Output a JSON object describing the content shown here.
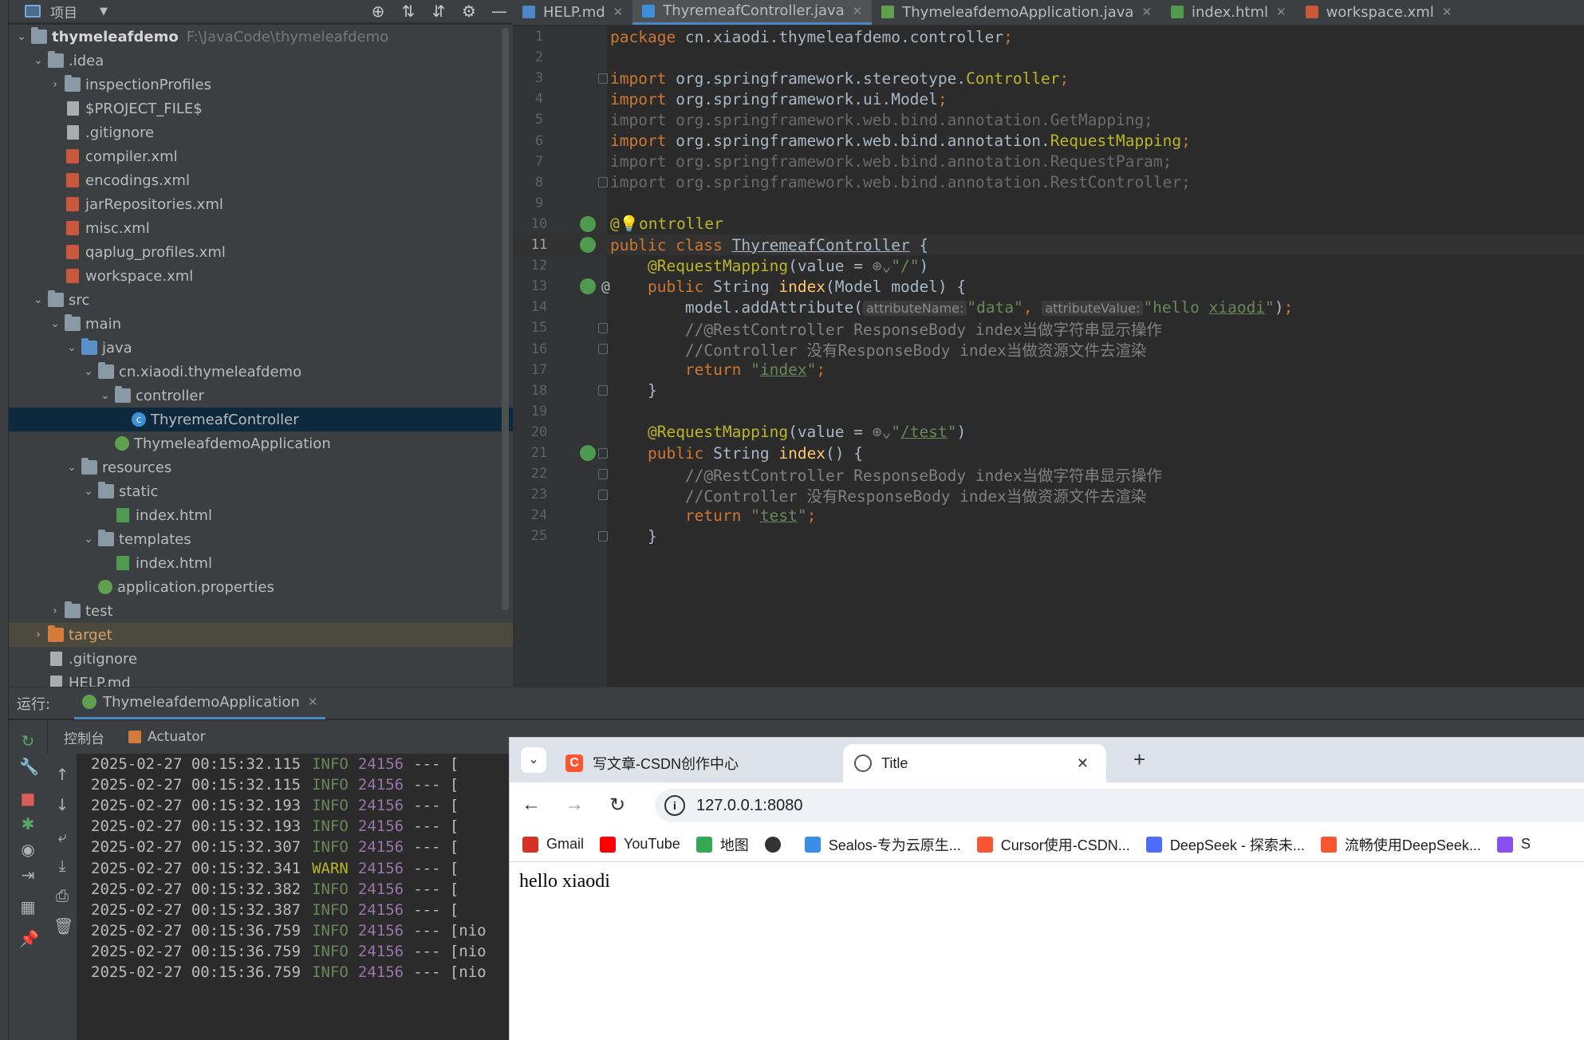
{
  "project_panel": {
    "title": "项目",
    "tree": [
      {
        "depth": 0,
        "arrow": "open",
        "icon": "folder",
        "label": "thymeleafdemo",
        "path": "F:\\JavaCode\\thymeleafdemo",
        "bold": true
      },
      {
        "depth": 1,
        "arrow": "open",
        "icon": "folder",
        "label": ".idea"
      },
      {
        "depth": 2,
        "arrow": "closed",
        "icon": "folder",
        "label": "inspectionProfiles"
      },
      {
        "depth": 2,
        "arrow": "none",
        "icon": "file",
        "label": "$PROJECT_FILE$"
      },
      {
        "depth": 2,
        "arrow": "none",
        "icon": "file",
        "label": ".gitignore"
      },
      {
        "depth": 2,
        "arrow": "none",
        "icon": "xml",
        "label": "compiler.xml"
      },
      {
        "depth": 2,
        "arrow": "none",
        "icon": "xml",
        "label": "encodings.xml"
      },
      {
        "depth": 2,
        "arrow": "none",
        "icon": "xml",
        "label": "jarRepositories.xml"
      },
      {
        "depth": 2,
        "arrow": "none",
        "icon": "xml",
        "label": "misc.xml"
      },
      {
        "depth": 2,
        "arrow": "none",
        "icon": "xml",
        "label": "qaplug_profiles.xml"
      },
      {
        "depth": 2,
        "arrow": "none",
        "icon": "xml",
        "label": "workspace.xml"
      },
      {
        "depth": 1,
        "arrow": "open",
        "icon": "folder",
        "label": "src"
      },
      {
        "depth": 2,
        "arrow": "open",
        "icon": "folder",
        "label": "main"
      },
      {
        "depth": 3,
        "arrow": "open",
        "icon": "folder-blue",
        "label": "java"
      },
      {
        "depth": 4,
        "arrow": "open",
        "icon": "folder",
        "label": "cn.xiaodi.thymeleafdemo"
      },
      {
        "depth": 5,
        "arrow": "open",
        "icon": "folder",
        "label": "controller"
      },
      {
        "depth": 6,
        "arrow": "none",
        "icon": "class",
        "label": "ThyremeafController",
        "selected": true
      },
      {
        "depth": 5,
        "arrow": "none",
        "icon": "spring",
        "label": "ThymeleafdemoApplication"
      },
      {
        "depth": 3,
        "arrow": "open",
        "icon": "folder",
        "label": "resources"
      },
      {
        "depth": 4,
        "arrow": "open",
        "icon": "folder",
        "label": "static"
      },
      {
        "depth": 5,
        "arrow": "none",
        "icon": "html",
        "label": "index.html"
      },
      {
        "depth": 4,
        "arrow": "open",
        "icon": "folder",
        "label": "templates"
      },
      {
        "depth": 5,
        "arrow": "none",
        "icon": "html",
        "label": "index.html"
      },
      {
        "depth": 4,
        "arrow": "none",
        "icon": "spring",
        "label": "application.properties"
      },
      {
        "depth": 2,
        "arrow": "closed",
        "icon": "folder",
        "label": "test"
      },
      {
        "depth": 1,
        "arrow": "closed",
        "icon": "folder-orange",
        "label": "target",
        "target": true
      },
      {
        "depth": 1,
        "arrow": "none",
        "icon": "file",
        "label": ".gitignore"
      },
      {
        "depth": 1,
        "arrow": "none",
        "icon": "file",
        "label": "HELP.md"
      }
    ]
  },
  "editor_tabs": [
    {
      "label": "HELP.md",
      "icon_color": "#4a88c7",
      "active": false
    },
    {
      "label": "ThyremeafController.java",
      "icon_color": "#3d8fd8",
      "active": true
    },
    {
      "label": "ThymeleafdemoApplication.java",
      "icon_color": "#5fa04e",
      "active": false
    },
    {
      "label": "index.html",
      "icon_color": "#4e9a4f",
      "active": false
    },
    {
      "label": "workspace.xml",
      "icon_color": "#c8573c",
      "active": false
    }
  ],
  "editor": {
    "current_line": 11,
    "lines": [
      {
        "n": 1,
        "tokens": [
          [
            "kw",
            "package "
          ],
          [
            "plain",
            "cn.xiaodi.thymeleafdemo.controller"
          ],
          [
            "kw",
            ";"
          ]
        ]
      },
      {
        "n": 2,
        "tokens": []
      },
      {
        "n": 3,
        "fold": true,
        "tokens": [
          [
            "kw",
            "import "
          ],
          [
            "plain",
            "org.springframework.stereotype."
          ],
          [
            "an",
            "Controller"
          ],
          [
            "kw",
            ";"
          ]
        ]
      },
      {
        "n": 4,
        "tokens": [
          [
            "kw",
            "import "
          ],
          [
            "plain",
            "org.springframework.ui.Model"
          ],
          [
            "kw",
            ";"
          ]
        ]
      },
      {
        "n": 5,
        "tokens": [
          [
            "dim",
            "import org.springframework.web.bind.annotation.GetMapping;"
          ]
        ]
      },
      {
        "n": 6,
        "tokens": [
          [
            "kw",
            "import "
          ],
          [
            "plain",
            "org.springframework.web.bind.annotation."
          ],
          [
            "an",
            "RequestMapping"
          ],
          [
            "kw",
            ";"
          ]
        ]
      },
      {
        "n": 7,
        "tokens": [
          [
            "dim",
            "import org.springframework.web.bind.annotation.RequestParam;"
          ]
        ]
      },
      {
        "n": 8,
        "fold": true,
        "tokens": [
          [
            "dim",
            "import org.springframework.web.bind.annotation.RestController;"
          ]
        ]
      },
      {
        "n": 9,
        "tokens": []
      },
      {
        "n": 10,
        "gicon": true,
        "tokens": [
          [
            "an",
            "@"
          ],
          [
            "fn",
            "💡"
          ],
          [
            "an",
            "ontroller"
          ]
        ]
      },
      {
        "n": 11,
        "gicon": true,
        "tokens": [
          [
            "kw",
            "public class "
          ],
          [
            "ulplain",
            "ThyremeafController"
          ],
          [
            "plain",
            " {"
          ]
        ]
      },
      {
        "n": 12,
        "tokens": [
          [
            "plain",
            "    "
          ],
          [
            "an",
            "@RequestMapping"
          ],
          [
            "plain",
            "(value = "
          ],
          [
            "cm",
            "⊕⌄"
          ],
          [
            "str",
            "\"/\""
          ],
          [
            "plain",
            ")"
          ]
        ]
      },
      {
        "n": 13,
        "gicon": true,
        "at": true,
        "fold": true,
        "tokens": [
          [
            "plain",
            "    "
          ],
          [
            "kw",
            "public "
          ],
          [
            "plain",
            "String "
          ],
          [
            "fn",
            "index"
          ],
          [
            "plain",
            "(Model model) {"
          ]
        ]
      },
      {
        "n": 14,
        "tokens": [
          [
            "plain",
            "        model.addAttribute("
          ],
          [
            "hint",
            "attributeName:"
          ],
          [
            "str",
            "\"data\""
          ],
          [
            "kw",
            ", "
          ],
          [
            "hint",
            "attributeValue:"
          ],
          [
            "str",
            "\"hello "
          ],
          [
            "ulstr",
            "xiaodi"
          ],
          [
            "str",
            "\""
          ],
          [
            "plain",
            ")"
          ],
          [
            "kw",
            ";"
          ]
        ]
      },
      {
        "n": 15,
        "fold": true,
        "tokens": [
          [
            "cm",
            "        //@RestController ResponseBody index当做字符串显示操作"
          ]
        ]
      },
      {
        "n": 16,
        "fold": true,
        "tokens": [
          [
            "cm",
            "        //Controller 没有ResponseBody index当做资源文件去渲染"
          ]
        ]
      },
      {
        "n": 17,
        "tokens": [
          [
            "plain",
            "        "
          ],
          [
            "kw",
            "return "
          ],
          [
            "str",
            "\""
          ],
          [
            "ulstr",
            "index"
          ],
          [
            "str",
            "\""
          ],
          [
            "kw",
            ";"
          ]
        ]
      },
      {
        "n": 18,
        "fold": true,
        "tokens": [
          [
            "plain",
            "    }"
          ]
        ]
      },
      {
        "n": 19,
        "tokens": []
      },
      {
        "n": 20,
        "tokens": [
          [
            "plain",
            "    "
          ],
          [
            "an",
            "@RequestMapping"
          ],
          [
            "plain",
            "(value = "
          ],
          [
            "cm",
            "⊕⌄"
          ],
          [
            "str",
            "\""
          ],
          [
            "ulstr",
            "/test"
          ],
          [
            "str",
            "\""
          ],
          [
            "plain",
            ")"
          ]
        ]
      },
      {
        "n": 21,
        "gicon": true,
        "fold": true,
        "tokens": [
          [
            "plain",
            "    "
          ],
          [
            "kw",
            "public "
          ],
          [
            "plain",
            "String "
          ],
          [
            "fn",
            "index"
          ],
          [
            "plain",
            "() {"
          ]
        ]
      },
      {
        "n": 22,
        "fold": true,
        "tokens": [
          [
            "cm",
            "        //@RestController ResponseBody index当做字符串显示操作"
          ]
        ]
      },
      {
        "n": 23,
        "fold": true,
        "tokens": [
          [
            "cm",
            "        //Controller 没有ResponseBody index当做资源文件去渲染"
          ]
        ]
      },
      {
        "n": 24,
        "tokens": [
          [
            "plain",
            "        "
          ],
          [
            "kw",
            "return "
          ],
          [
            "str",
            "\""
          ],
          [
            "ulstr",
            "test"
          ],
          [
            "str",
            "\""
          ],
          [
            "kw",
            ";"
          ]
        ]
      },
      {
        "n": 25,
        "fold": true,
        "tokens": [
          [
            "plain",
            "    }"
          ]
        ]
      }
    ]
  },
  "run_panel": {
    "label": "运行:",
    "run_tab": "ThymeleafdemoApplication",
    "console_tab": "控制台",
    "actuator_tab": "Actuator",
    "log": [
      {
        "ts": "2025-02-27 00:15:32.115",
        "level": "INFO",
        "pid": "24156",
        "rest": "--- ["
      },
      {
        "ts": "2025-02-27 00:15:32.115",
        "level": "INFO",
        "pid": "24156",
        "rest": "--- ["
      },
      {
        "ts": "2025-02-27 00:15:32.193",
        "level": "INFO",
        "pid": "24156",
        "rest": "--- ["
      },
      {
        "ts": "2025-02-27 00:15:32.193",
        "level": "INFO",
        "pid": "24156",
        "rest": "--- ["
      },
      {
        "ts": "2025-02-27 00:15:32.307",
        "level": "INFO",
        "pid": "24156",
        "rest": "--- ["
      },
      {
        "ts": "2025-02-27 00:15:32.341",
        "level": "WARN",
        "pid": "24156",
        "rest": "--- ["
      },
      {
        "ts": "2025-02-27 00:15:32.382",
        "level": "INFO",
        "pid": "24156",
        "rest": "--- ["
      },
      {
        "ts": "2025-02-27 00:15:32.387",
        "level": "INFO",
        "pid": "24156",
        "rest": "--- ["
      },
      {
        "ts": "2025-02-27 00:15:36.759",
        "level": "INFO",
        "pid": "24156",
        "rest": "--- [nio"
      },
      {
        "ts": "2025-02-27 00:15:36.759",
        "level": "INFO",
        "pid": "24156",
        "rest": "--- [nio"
      },
      {
        "ts": "2025-02-27 00:15:36.759",
        "level": "INFO",
        "pid": "24156",
        "rest": "--- [nio"
      }
    ]
  },
  "browser": {
    "tabs": [
      {
        "title": "写文章-CSDN创作中心",
        "favicon": "csdn-icon",
        "active": false
      },
      {
        "title": "Title",
        "favicon": "globe-icon",
        "active": true
      }
    ],
    "url": "127.0.0.1:8080",
    "bookmarks": [
      {
        "label": "Gmail",
        "icon": "gmail-icon",
        "color": "#d93025"
      },
      {
        "label": "YouTube",
        "icon": "youtube-icon",
        "color": "#ff0000"
      },
      {
        "label": "地图",
        "icon": "maps-icon",
        "color": "#34a853"
      },
      {
        "label": "",
        "icon": "globe-icon",
        "color": "#333333"
      },
      {
        "label": "Sealos-专为云原生...",
        "icon": "sealos-icon",
        "color": "#3a8ee6"
      },
      {
        "label": "Cursor使用-CSDN...",
        "icon": "csdn-icon",
        "color": "#fc5531"
      },
      {
        "label": "DeepSeek - 探索未...",
        "icon": "deepseek-icon",
        "color": "#4d6bfe"
      },
      {
        "label": "流畅使用DeepSeek...",
        "icon": "csdn-icon",
        "color": "#fc5531"
      },
      {
        "label": "S",
        "icon": "app-icon",
        "color": "#8a4ff0"
      }
    ],
    "page_text": "hello xiaodi"
  }
}
